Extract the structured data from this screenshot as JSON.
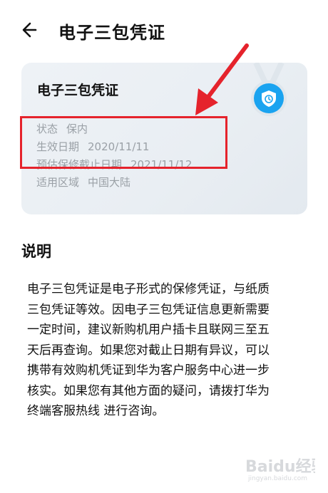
{
  "header": {
    "title": "电子三包凭证",
    "back_icon": "arrow-left-icon"
  },
  "card": {
    "title": "电子三包凭证",
    "badge_icon": "shield-clock-icon",
    "rows": [
      {
        "label": "状态",
        "value": "保内"
      },
      {
        "label": "生效日期",
        "value": "2020/11/11"
      },
      {
        "label": "预估保修截止日期",
        "value": "2021/11/12"
      },
      {
        "label": "适用区域",
        "value": "中国大陆"
      }
    ]
  },
  "section": {
    "title": "说明",
    "body": "电子三包凭证是电子形式的保修凭证，与纸质\n三包凭证等效。因电子三包凭证信息更新需要\n一定时间，建议新购机用户插卡且联网三至五\n天后再查询。如果您对截止日期有异议，可以\n携带有效购机凭证到华为客户服务中心进一步\n核实。如果您有其他方面的疑问，请拨打华为\n终端客服热线          进行咨询。"
  },
  "annotations": {
    "highlight_color": "#e5232c",
    "arrow_color": "#e5232c"
  },
  "colors": {
    "accent": "#1aa3f0",
    "muted_text": "#9aa0a6"
  },
  "watermark": {
    "text": "Baidu经验",
    "sub": "jingyan.baidu.com"
  }
}
